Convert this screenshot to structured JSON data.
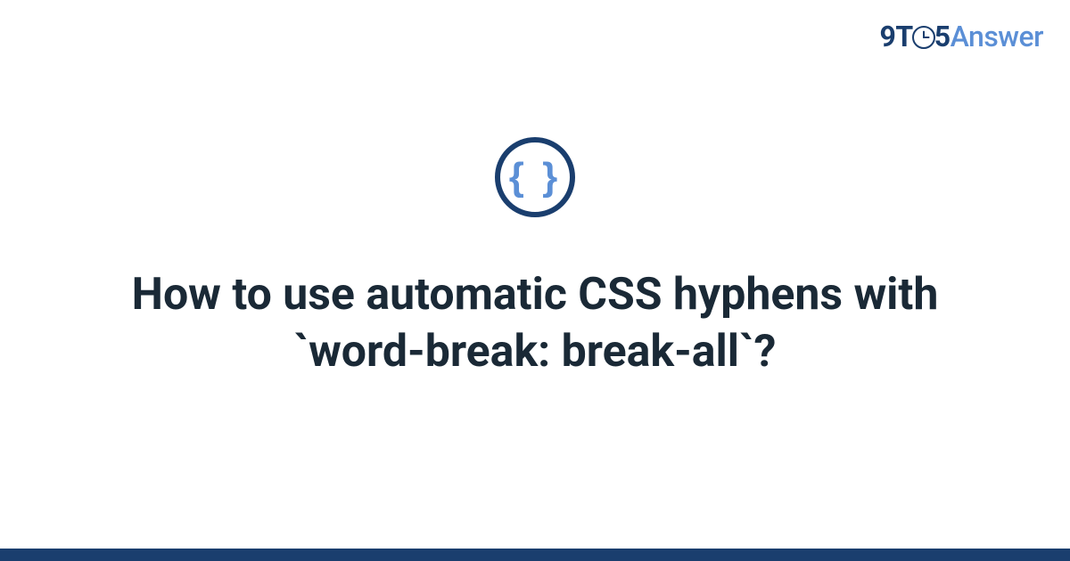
{
  "logo": {
    "part1": "9T",
    "part2": "5",
    "answer": "Answer"
  },
  "category_icon": {
    "name": "css-braces-icon",
    "symbol": "{ }"
  },
  "title": "How to use automatic CSS hyphens with `word-break: break-all`?",
  "colors": {
    "brand_dark": "#1a3e6e",
    "brand_light": "#5b8fd6",
    "text": "#1a2936"
  }
}
